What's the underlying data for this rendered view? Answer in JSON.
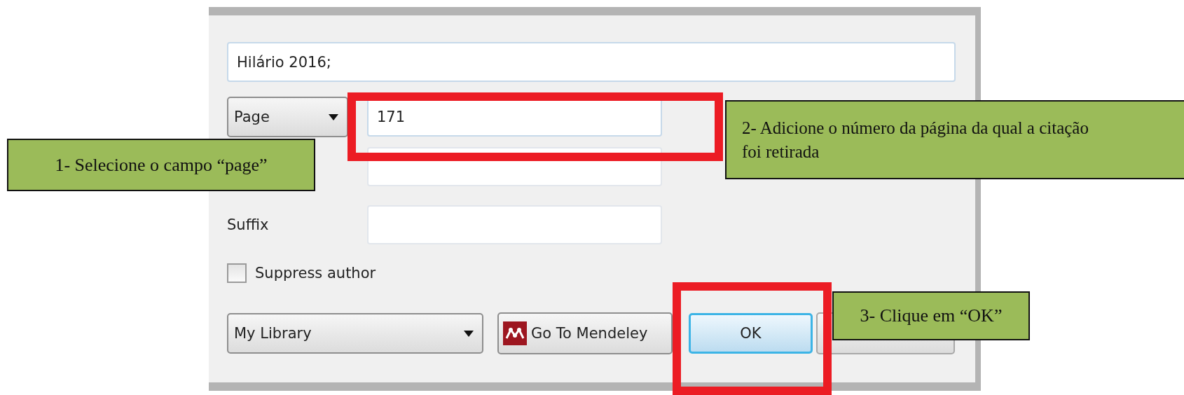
{
  "citation_field": {
    "value": "Hilário 2016;"
  },
  "locator": {
    "type": "Page",
    "value": "171"
  },
  "suffix": {
    "label": "Suffix"
  },
  "suppress_author": {
    "label": "Suppress author",
    "checked": false
  },
  "library": {
    "value": "My Library"
  },
  "buttons": [
    {
      "kind": "mendeley",
      "label": "Go To Mendeley"
    },
    {
      "kind": "ok",
      "label": "OK"
    },
    {
      "kind": "cancel"
    }
  ],
  "callouts": [
    {
      "text": "1- Selecione o campo “page”"
    },
    {
      "text": "2- Adicione o número da página da qual a citação foi retirada"
    },
    {
      "text": "3- Clique em “OK”"
    }
  ]
}
